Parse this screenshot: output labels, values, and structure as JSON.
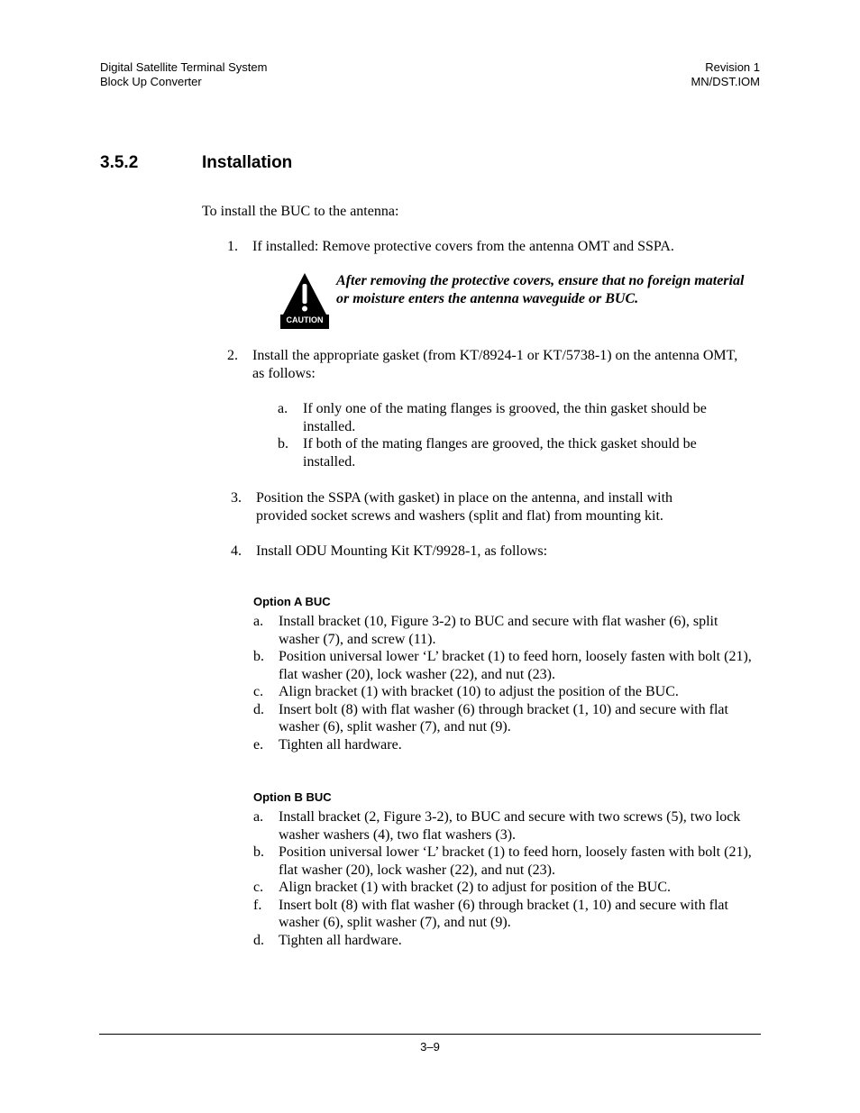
{
  "header": {
    "left_line1": "Digital Satellite Terminal System",
    "left_line2": "Block Up Converter",
    "right_line1": "Revision 1",
    "right_line2": "MN/DST.IOM"
  },
  "section": {
    "number": "3.5.2",
    "title": "Installation"
  },
  "intro": "To install the BUC to the antenna:",
  "steps": [
    {
      "num": "1.",
      "text": "If installed: Remove protective covers from the antenna OMT and SSPA."
    },
    {
      "num": "2.",
      "text": "Install the appropriate gasket (from KT/8924-1 or KT/5738-1) on the antenna OMT, as follows:",
      "sub": [
        {
          "lbl": "a.",
          "text": "If only one of the mating flanges is grooved, the thin gasket should be installed."
        },
        {
          "lbl": "b.",
          "text": "If both of the mating flanges are grooved, the thick gasket should be installed."
        }
      ]
    },
    {
      "num": "3.",
      "text": "Position the SSPA (with gasket) in place on the antenna, and install with provided socket screws and washers (split and flat) from mounting kit."
    },
    {
      "num": "4.",
      "text": "Install ODU Mounting Kit KT/9928-1, as follows:"
    }
  ],
  "caution": {
    "icon_label": "CAUTION",
    "icon": "caution-triangle-icon",
    "text": "After removing the protective covers, ensure that no foreign material or moisture enters the antenna waveguide or BUC."
  },
  "option_a": {
    "heading": "Option A BUC",
    "items": [
      {
        "lbl": "a.",
        "text": "Install bracket (10, Figure 3-2) to BUC and secure with flat washer (6), split washer (7), and screw (11)."
      },
      {
        "lbl": "b.",
        "text": "Position universal lower ‘L’ bracket (1) to feed horn, loosely fasten with bolt (21), flat washer (20), lock washer (22), and nut (23)."
      },
      {
        "lbl": "c.",
        "text": "Align bracket (1) with bracket (10) to adjust the position of the BUC."
      },
      {
        "lbl": "d.",
        "text": "Insert bolt (8) with flat washer (6) through bracket (1, 10) and secure with flat washer (6), split washer (7), and nut (9)."
      },
      {
        "lbl": "e.",
        "text": "Tighten all hardware."
      }
    ]
  },
  "option_b": {
    "heading": "Option B BUC",
    "items": [
      {
        "lbl": "a.",
        "text": "Install bracket (2, Figure 3-2), to BUC and secure with two screws (5), two lock washer washers (4), two flat washers (3)."
      },
      {
        "lbl": "b.",
        "text": "Position universal lower ‘L’ bracket (1) to feed horn, loosely fasten with bolt (21), flat washer (20), lock washer (22), and nut (23)."
      },
      {
        "lbl": "c.",
        "text": "Align bracket (1) with bracket (2) to adjust for position of the BUC."
      },
      {
        "lbl": "f.",
        "text": "Insert bolt (8) with flat washer (6) through bracket (1, 10) and secure with flat washer (6), split washer (7), and nut (9)."
      },
      {
        "lbl": "d.",
        "text": "Tighten all hardware."
      }
    ]
  },
  "footer": {
    "page_number": "3–9"
  }
}
